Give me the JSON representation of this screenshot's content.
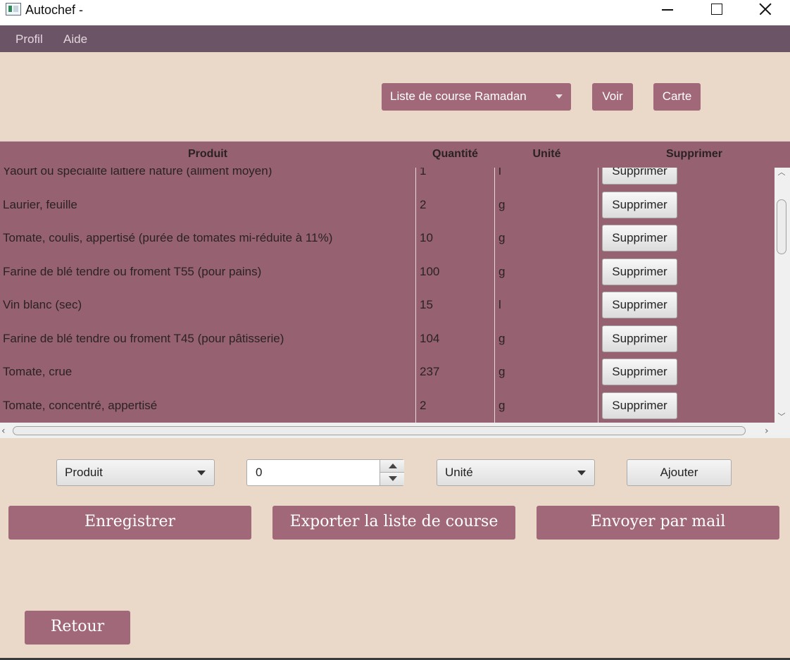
{
  "window": {
    "title": "Autochef -"
  },
  "menu": {
    "items": [
      "Profil",
      "Aide"
    ]
  },
  "top": {
    "list_select": "Liste de course Ramadan",
    "voir_label": "Voir",
    "carte_label": "Carte"
  },
  "table": {
    "headers": [
      "Produit",
      "Quantité",
      "Unité",
      "Supprimer"
    ],
    "rows": [
      {
        "produit": "Yaourt ou spécialité laitière nature (aliment moyen)",
        "quantite": "1",
        "unite": "l",
        "supprimer": "Supprimer"
      },
      {
        "produit": "Laurier, feuille",
        "quantite": "2",
        "unite": "g",
        "supprimer": "Supprimer"
      },
      {
        "produit": "Tomate, coulis, appertisé (purée de tomates mi-réduite à 11%)",
        "quantite": "10",
        "unite": "g",
        "supprimer": "Supprimer"
      },
      {
        "produit": "Farine de blé tendre ou froment T55 (pour pains)",
        "quantite": "100",
        "unite": "g",
        "supprimer": "Supprimer"
      },
      {
        "produit": "Vin blanc (sec)",
        "quantite": "15",
        "unite": "l",
        "supprimer": "Supprimer"
      },
      {
        "produit": "Farine de blé tendre ou froment T45 (pour pâtisserie)",
        "quantite": "104",
        "unite": "g",
        "supprimer": "Supprimer"
      },
      {
        "produit": "Tomate, crue",
        "quantite": "237",
        "unite": "g",
        "supprimer": "Supprimer"
      },
      {
        "produit": "Tomate, concentré, appertisé",
        "quantite": "2",
        "unite": "g",
        "supprimer": "Supprimer"
      }
    ]
  },
  "add_row": {
    "produit_select": "Produit",
    "quantite_value": "0",
    "unite_select": "Unité",
    "ajouter_label": "Ajouter"
  },
  "actions": {
    "save_label": "Enregistrer",
    "export_label": "Exporter la liste de course",
    "mail_label": "Envoyer par mail",
    "retour_label": "Retour"
  }
}
